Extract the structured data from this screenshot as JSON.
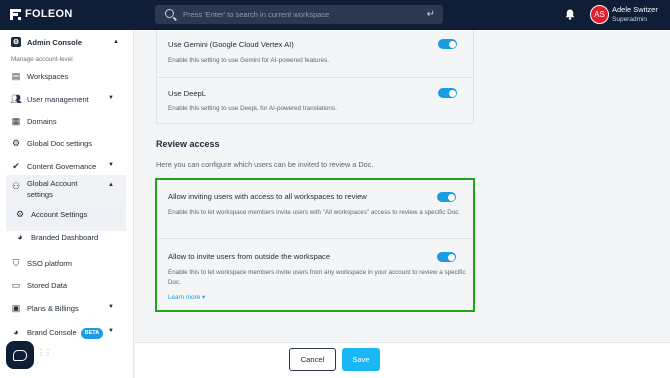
{
  "topbar": {
    "logo_text": "FOLEON",
    "search_placeholder": "Press 'Enter' to search in current workspace",
    "enter_icon": "↵",
    "user_initials": "AS",
    "user_name": "Adele Switzer",
    "user_role": "Superadmin"
  },
  "sidebar": {
    "header": "Admin Console",
    "subheader": "Manage account-level",
    "items": [
      {
        "label": "Workspaces",
        "icon": "workspaces-icon"
      },
      {
        "label": "User management",
        "icon": "users-icon"
      },
      {
        "label": "Domains",
        "icon": "domains-icon"
      },
      {
        "label": "Global Doc settings",
        "icon": "gear-icon"
      },
      {
        "label": "Content Governance",
        "icon": "shield-check-icon"
      },
      {
        "label": "Global Account",
        "label2": "settings",
        "icon": "account-settings-icon"
      },
      {
        "label": "Account Settings",
        "icon": "gear-icon"
      },
      {
        "label": "Branded Dashboard",
        "icon": "palette-icon"
      },
      {
        "label": "SSO platform",
        "icon": "shield-icon"
      },
      {
        "label": "Stored Data",
        "icon": "database-icon"
      },
      {
        "label": "Plans & Billings",
        "icon": "billing-icon"
      },
      {
        "label": "Brand Console",
        "icon": "palette-icon",
        "badge": "BETA"
      }
    ]
  },
  "settings_top": [
    {
      "title": "Use Gemini (Google Cloud Vertex AI)",
      "desc": "Enable this setting to use Gemini for AI-powered features.",
      "enabled": true
    },
    {
      "title": "Use DeepL",
      "desc": "Enable this setting to use DeepL for AI-powered translations.",
      "enabled": true
    }
  ],
  "review": {
    "title": "Review access",
    "desc": "Here you can configure which users can be invited to review a Doc.",
    "items": [
      {
        "title": "Allow inviting users with access to all workspaces to review",
        "desc": "Enable this to let workspace members invite users with \"All workspaces\" access to review a specific Doc.",
        "enabled": true
      },
      {
        "title": "Allow to invite users from outside the workspace",
        "desc": "Enable this to let workspace members invite users from any workspace in your account to review a specific Doc.",
        "enabled": true,
        "link": "Learn more"
      }
    ]
  },
  "footer": {
    "cancel_label": "Cancel",
    "save_label": "Save"
  },
  "colors": {
    "topbar": "#0f1d36",
    "accent": "#1a9ce0",
    "highlight": "#1fa41a",
    "avatar": "#e11d2e"
  }
}
